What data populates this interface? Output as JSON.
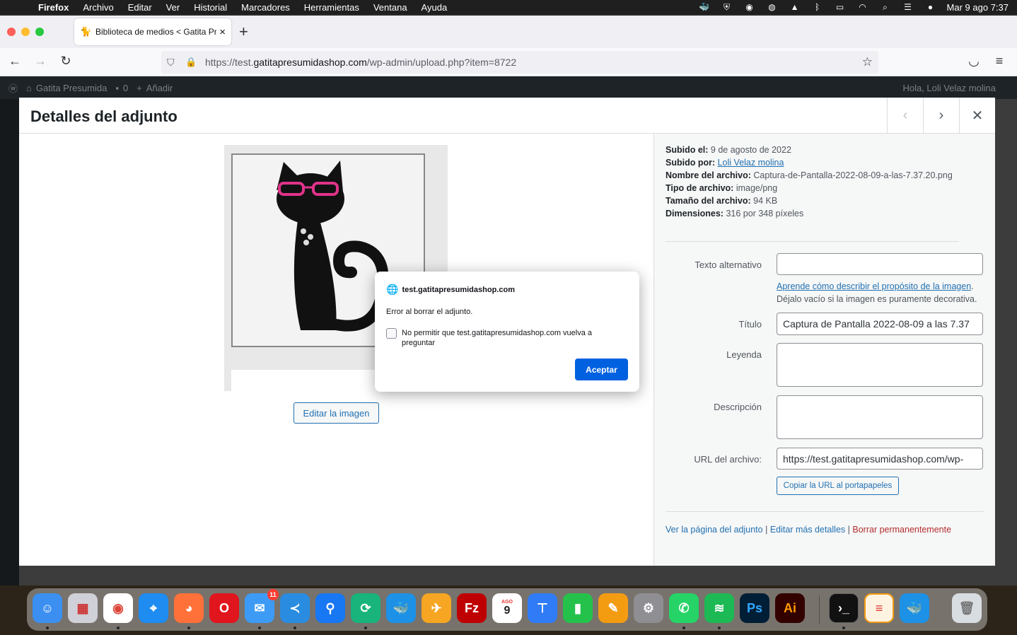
{
  "menubar": {
    "app": "Firefox",
    "items": [
      "Archivo",
      "Editar",
      "Ver",
      "Historial",
      "Marcadores",
      "Herramientas",
      "Ventana",
      "Ayuda"
    ],
    "clock": "Mar 9 ago  7:37"
  },
  "browser": {
    "tab_title": "Biblioteca de medios < Gatita Pr",
    "url_prefix": "https://test.",
    "url_host": "gatitapresumidashop.com",
    "url_path": "/wp-admin/upload.php?item=8722"
  },
  "adminbar": {
    "site": "Gatita Presumida",
    "comments": "0",
    "add": "Añadir",
    "greeting": "Hola, Loli Velaz molina"
  },
  "modal": {
    "title": "Detalles del adjunto",
    "edit_image": "Editar la imagen",
    "meta": {
      "uploaded_on_label": "Subido el:",
      "uploaded_on": "9 de agosto de 2022",
      "uploaded_by_label": "Subido por:",
      "uploaded_by": "Loli Velaz molina",
      "filename_label": "Nombre del archivo:",
      "filename": "Captura-de-Pantalla-2022-08-09-a-las-7.37.20.png",
      "filetype_label": "Tipo de archivo:",
      "filetype": "image/png",
      "filesize_label": "Tamaño del archivo:",
      "filesize": "94 KB",
      "dimensions_label": "Dimensiones:",
      "dimensions": "316 por 348 píxeles"
    },
    "fields": {
      "alt_label": "Texto alternativo",
      "alt_value": "",
      "alt_help_link": "Aprende cómo describir el propósito de la imagen",
      "alt_help_text": "Déjalo vacío si la imagen es puramente decorativa.",
      "title_label": "Título",
      "title_value": "Captura de Pantalla 2022-08-09 a las 7.37",
      "caption_label": "Leyenda",
      "caption_value": "",
      "description_label": "Descripción",
      "description_value": "",
      "url_label": "URL del archivo:",
      "url_value": "https://test.gatitapresumidashop.com/wp-",
      "copy_url": "Copiar la URL al portapapeles"
    },
    "actions": {
      "view": "Ver la página del adjunto",
      "edit": "Editar más detalles",
      "delete": "Borrar permanentemente",
      "sep": "|"
    }
  },
  "dialog": {
    "origin": "test.gatitapresumidashop.com",
    "message": "Error al borrar el adjunto.",
    "checkbox_label": "No permitir que test.gatitapresumidashop.com vuelva a preguntar",
    "ok": "Aceptar"
  },
  "dock": {
    "mail_badge": "11",
    "calendar_month": "AGO",
    "calendar_day": "9"
  }
}
